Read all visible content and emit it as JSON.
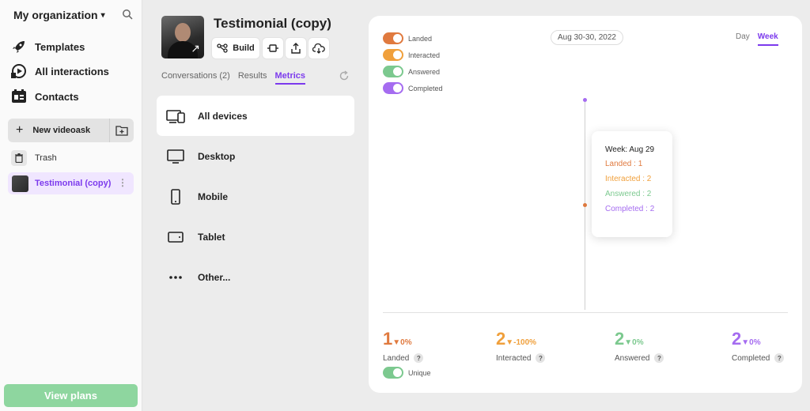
{
  "sidebar": {
    "org_name": "My organization",
    "nav": [
      {
        "label": "Templates",
        "icon": "rocket-icon"
      },
      {
        "label": "All interactions",
        "icon": "play-icon"
      },
      {
        "label": "Contacts",
        "icon": "contacts-icon"
      }
    ],
    "new_videoask_label": "New videoask",
    "trash_label": "Trash",
    "selected_item_label": "Testimonial (copy)",
    "view_plans_label": "View plans"
  },
  "videoask": {
    "title": "Testimonial (copy)",
    "build_label": "Build",
    "tabs": [
      {
        "label": "Conversations (2)",
        "active": false
      },
      {
        "label": "Results",
        "active": false
      },
      {
        "label": "Metrics",
        "active": true
      }
    ]
  },
  "devices": [
    {
      "label": "All devices",
      "icon": "all-devices-icon",
      "active": true
    },
    {
      "label": "Desktop",
      "icon": "desktop-icon",
      "active": false
    },
    {
      "label": "Mobile",
      "icon": "mobile-icon",
      "active": false
    },
    {
      "label": "Tablet",
      "icon": "tablet-icon",
      "active": false
    },
    {
      "label": "Other...",
      "icon": "more-icon",
      "active": false
    }
  ],
  "metrics": {
    "date_range": "Aug 30-30, 2022",
    "period_day": "Day",
    "period_week": "Week",
    "unique_label": "Unique"
  },
  "chart_data": {
    "type": "line",
    "series": [
      {
        "name": "Landed",
        "color": "#e07a3f",
        "values": [
          1
        ]
      },
      {
        "name": "Interacted",
        "color": "#f0a03c",
        "values": [
          2
        ]
      },
      {
        "name": "Answered",
        "color": "#7cc98f",
        "values": [
          2
        ]
      },
      {
        "name": "Completed",
        "color": "#a56cf0",
        "values": [
          2
        ]
      }
    ],
    "categories": [
      "Aug 29"
    ],
    "tooltip": {
      "header": "Week: Aug 29",
      "rows": [
        "Landed : 1",
        "Interacted : 2",
        "Answered : 2",
        "Completed : 2"
      ]
    },
    "stats": [
      {
        "value": "1",
        "change": "0%",
        "label": "Landed",
        "color": "#e07a3f"
      },
      {
        "value": "2",
        "change": "-100%",
        "label": "Interacted",
        "color": "#f0a03c"
      },
      {
        "value": "2",
        "change": "0%",
        "label": "Answered",
        "color": "#7cc98f"
      },
      {
        "value": "2",
        "change": "0%",
        "label": "Completed",
        "color": "#a56cf0"
      }
    ],
    "legend_position": "top-left",
    "ylim": [
      0,
      2
    ]
  }
}
